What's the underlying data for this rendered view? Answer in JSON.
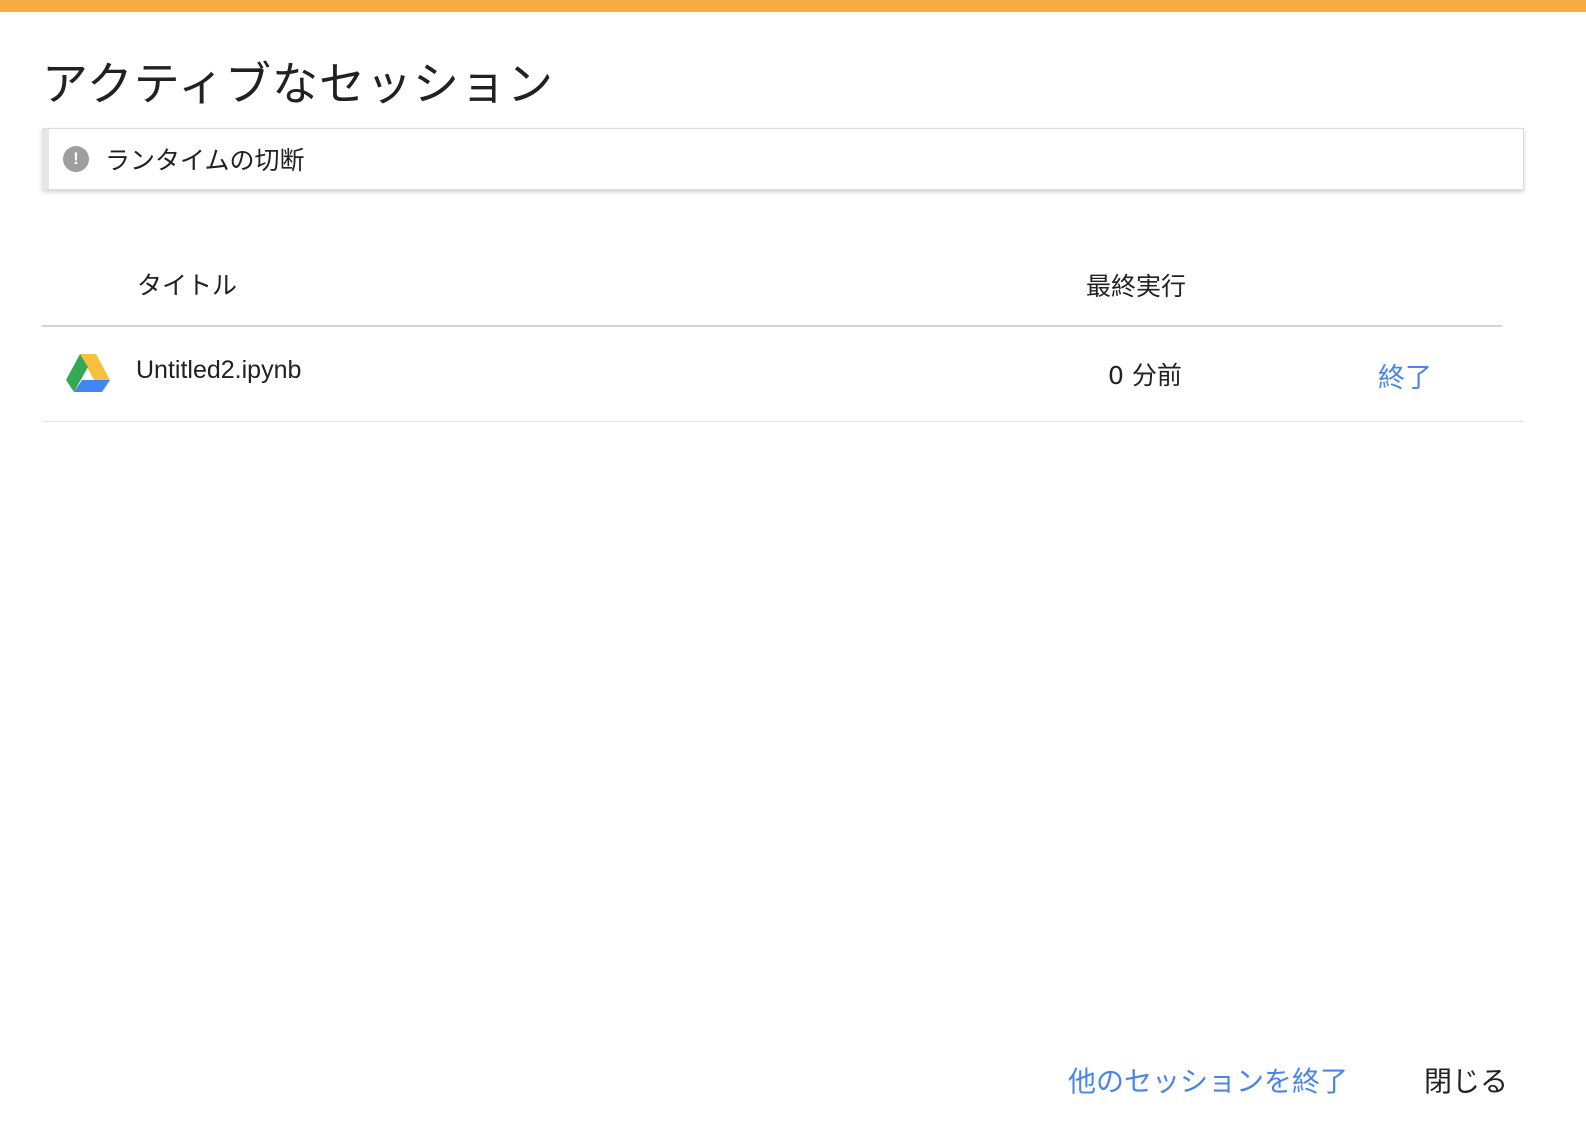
{
  "dialog": {
    "title": "アクティブなセッション",
    "accent_color": "#f9ab45"
  },
  "notice": {
    "icon": "alert-circle-icon",
    "text": "ランタイムの切断"
  },
  "table": {
    "columns": {
      "title": "タイトル",
      "last_run": "最終実行"
    },
    "rows": [
      {
        "icon": "google-drive-icon",
        "title": "Untitled2.ipynb",
        "last_run": "0 分前",
        "action": "終了"
      }
    ]
  },
  "footer": {
    "terminate_others": "他のセッションを終了",
    "close": "閉じる"
  },
  "colors": {
    "link": "#4a86e8",
    "text": "#212121"
  }
}
